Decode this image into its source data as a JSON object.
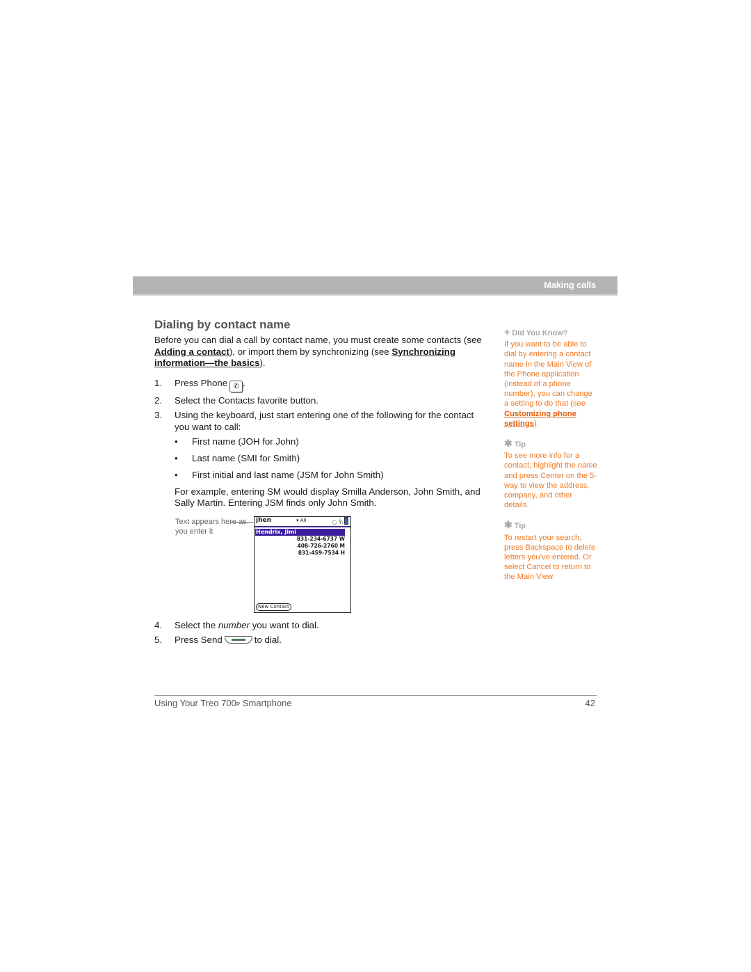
{
  "header": {
    "section": "Making calls"
  },
  "main": {
    "title": "Dialing by contact name",
    "intro": {
      "part1": "Before you can dial a call by contact name, you must create some contacts (see ",
      "link1": "Adding a contact",
      "part2": "), or import them by synchronizing (see ",
      "link2": "Synchronizing information—the basics",
      "part3": ")."
    },
    "steps": [
      {
        "num": "1.",
        "text": "Press Phone",
        "after": "."
      },
      {
        "num": "2.",
        "text": "Select the Contacts favorite button."
      },
      {
        "num": "3.",
        "text": "Using the keyboard, just start entering one of the following for the contact you want to call:"
      },
      {
        "num": "4.",
        "pre": "Select the ",
        "em": "number",
        "post": " you want to dial."
      },
      {
        "num": "5.",
        "text": "Press Send",
        "after": "to dial."
      }
    ],
    "bullets": [
      "First name (JOH for John)",
      "Last name (SMI for Smith)",
      "First initial and last name (JSM for John Smith)"
    ],
    "bullet_glyph": "•",
    "example": "For example, entering SM would display Smilla Anderson, John Smith, and Sally Martin. Entering JSM finds only John Smith.",
    "figure": {
      "callout": "Text appears here as you enter it",
      "device": {
        "search_text": "jhen",
        "filter": "▾ All",
        "status": "○ Ŷₗ",
        "highlighted_contact": "Hendrix, Jimi",
        "numbers": [
          "831-234-6737 W",
          "408-726-2760 M",
          "831-459-7534 H"
        ],
        "new_contact_button": "New Contact"
      }
    }
  },
  "sidebar": {
    "did_you_know": {
      "icon": "+",
      "heading": "Did You Know?",
      "text": "If you want to be able to dial by entering a contact name in the Main View of the Phone application (instead of a phone number), you can change a setting to do that (see ",
      "link": "Customizing phone settings",
      "after": ")."
    },
    "tip1": {
      "icon": "✱",
      "heading": "Tip",
      "pre": "To see more info for a contact, highlight the ",
      "em": "name",
      "post": " and press Center on the 5-way to view the address, company, and other details."
    },
    "tip2": {
      "icon": "✱",
      "heading": "Tip",
      "text": "To restart your search, press Backspace to delete letters you’ve entered. Or select Cancel to return to the Main View."
    }
  },
  "footer": {
    "title_pre": "Using Your Treo 700",
    "title_sub": "P",
    "title_post": " Smartphone",
    "page": "42"
  }
}
